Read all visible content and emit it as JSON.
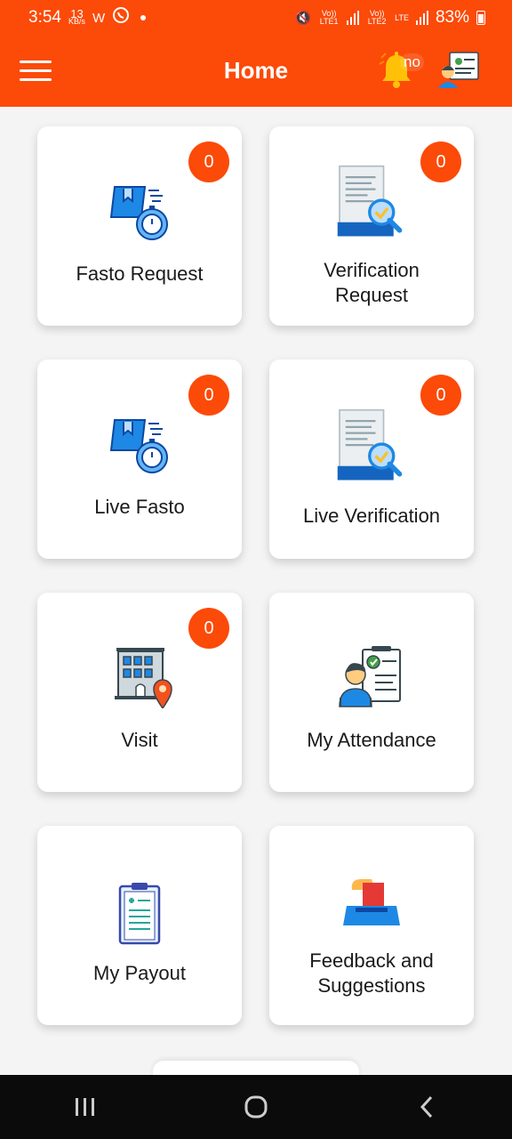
{
  "status_bar": {
    "time": "3:54",
    "speed_value": "13",
    "speed_unit": "KB/s",
    "net1_label": "Vo)) LTE1",
    "net2_label": "Vo)) LTE2",
    "lte_label": "LTE",
    "battery": "83%"
  },
  "app_bar": {
    "title": "Home",
    "bell_label": "no",
    "menu_icon": "hamburger-menu-icon",
    "bell_icon": "bell-icon",
    "profile_icon": "user-profile-icon"
  },
  "colors": {
    "primary": "#fc4a08",
    "card_bg": "#ffffff",
    "page_bg": "#f4f4f4",
    "nav_bg": "#0b0b0b"
  },
  "cards": [
    {
      "label": "Fasto Request",
      "badge": "0",
      "icon": "delivery-box-stopwatch-icon"
    },
    {
      "label": "Verification Request",
      "badge": "0",
      "icon": "document-verification-icon"
    },
    {
      "label": "Live Fasto",
      "badge": "0",
      "icon": "delivery-box-stopwatch-icon"
    },
    {
      "label": "Live Verification",
      "badge": "0",
      "icon": "document-verification-icon"
    },
    {
      "label": "Visit",
      "badge": "0",
      "icon": "building-location-icon"
    },
    {
      "label": "My Attendance",
      "icon": "attendance-checklist-icon"
    },
    {
      "label": "My Payout",
      "icon": "clipboard-medical-icon"
    },
    {
      "label": "Feedback and Suggestions",
      "icon": "ballot-box-icon"
    }
  ],
  "nav_bar": {
    "recents_icon": "recents-icon",
    "home_icon": "home-circle-icon",
    "back_icon": "back-chevron-icon"
  }
}
